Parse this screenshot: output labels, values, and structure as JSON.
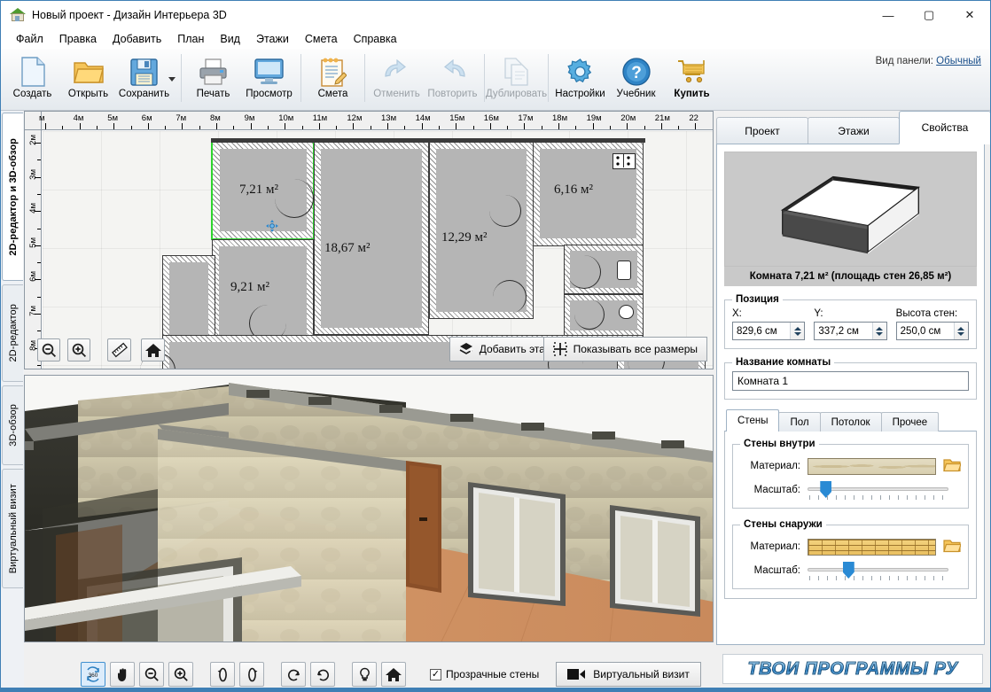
{
  "window": {
    "title": "Новый проект - Дизайн Интерьера 3D",
    "icon": "house-icon",
    "minimize": "—",
    "maximize": "▢",
    "close": "✕"
  },
  "menubar": {
    "items": [
      {
        "label": "Файл",
        "name": "menu-file"
      },
      {
        "label": "Правка",
        "name": "menu-edit"
      },
      {
        "label": "Добавить",
        "name": "menu-add"
      },
      {
        "label": "План",
        "name": "menu-plan"
      },
      {
        "label": "Вид",
        "name": "menu-view"
      },
      {
        "label": "Этажи",
        "name": "menu-floors"
      },
      {
        "label": "Смета",
        "name": "menu-estimate"
      },
      {
        "label": "Справка",
        "name": "menu-help"
      }
    ]
  },
  "ribbon": {
    "buttons": [
      {
        "label": "Создать",
        "icon": "new-document-icon",
        "enabled": true
      },
      {
        "label": "Открыть",
        "icon": "open-folder-icon",
        "enabled": true
      },
      {
        "label": "Сохранить",
        "icon": "save-floppy-icon",
        "enabled": true
      },
      {
        "label": "Печать",
        "icon": "printer-icon",
        "enabled": true
      },
      {
        "label": "Просмотр",
        "icon": "monitor-preview-icon",
        "enabled": true
      },
      {
        "label": "Смета",
        "icon": "notepad-estimate-icon",
        "enabled": true
      },
      {
        "label": "Отменить",
        "icon": "undo-arrow-icon",
        "enabled": false
      },
      {
        "label": "Повторить",
        "icon": "redo-arrow-icon",
        "enabled": false
      },
      {
        "label": "Дублировать",
        "icon": "duplicate-pages-icon",
        "enabled": false
      },
      {
        "label": "Настройки",
        "icon": "gear-icon",
        "enabled": true
      },
      {
        "label": "Учебник",
        "icon": "question-help-icon",
        "enabled": true
      },
      {
        "label": "Купить",
        "icon": "shopping-cart-icon",
        "enabled": true
      }
    ],
    "panel_view_label": "Вид панели:",
    "panel_view_value": "Обычный"
  },
  "left_tabs": [
    {
      "label": "2D-редактор и 3D-обзор",
      "active": true
    },
    {
      "label": "2D-редактор",
      "active": false
    },
    {
      "label": "3D-обзор",
      "active": false
    },
    {
      "label": "Виртуальный визит",
      "active": false
    }
  ],
  "plan": {
    "ruler_h_labels": [
      "м",
      "4м",
      "5м",
      "6м",
      "7м",
      "8м",
      "9м",
      "10м",
      "11м",
      "12м",
      "13м",
      "14м",
      "15м",
      "16м",
      "17м",
      "18м",
      "19м",
      "20м",
      "21м",
      "22"
    ],
    "ruler_v_labels": [
      "2м",
      "3м",
      "4м",
      "5м",
      "6м",
      "7м",
      "8м"
    ],
    "rooms": [
      {
        "area_label": "7,21 м²",
        "selected": true
      },
      {
        "area_label": "18,67 м²",
        "selected": false
      },
      {
        "area_label": "9,21 м²",
        "selected": false
      },
      {
        "area_label": "12,29 м²",
        "selected": false
      },
      {
        "area_label": "6,16 м²",
        "selected": false
      }
    ],
    "tools": [
      {
        "name": "zoom-out-icon",
        "glyph": "zoom-out"
      },
      {
        "name": "zoom-in-icon",
        "glyph": "zoom-in"
      },
      {
        "name": "ruler-icon",
        "glyph": "ruler"
      },
      {
        "name": "home-icon",
        "glyph": "home"
      }
    ],
    "add_floor_label": "Добавить этаж",
    "show_all_sizes_label": "Показывать все размеры"
  },
  "bottom_toolbar": {
    "buttons": [
      {
        "name": "orbit-360-icon",
        "label": "360",
        "active": true
      },
      {
        "name": "pan-hand-icon",
        "label": "✋",
        "active": false
      },
      {
        "name": "zoom-out-icon",
        "label": "−",
        "active": false
      },
      {
        "name": "zoom-in-icon",
        "label": "+",
        "active": false
      },
      {
        "name": "rotate-left-icon",
        "label": "↺",
        "active": false
      },
      {
        "name": "rotate-right-icon",
        "label": "↻",
        "active": false
      },
      {
        "name": "tilt-ccw-icon",
        "label": "⟲",
        "active": false
      },
      {
        "name": "tilt-cw-icon",
        "label": "⟳",
        "active": false
      },
      {
        "name": "light-bulb-icon",
        "label": "💡",
        "active": false
      },
      {
        "name": "home-icon",
        "label": "⌂",
        "active": false
      }
    ],
    "transparent_walls_label": "Прозрачные стены",
    "transparent_walls_checked": true,
    "virtual_visit_label": "Виртуальный визит"
  },
  "right_panel": {
    "tabs": [
      {
        "label": "Проект",
        "active": false
      },
      {
        "label": "Этажи",
        "active": false
      },
      {
        "label": "Свойства",
        "active": true
      }
    ],
    "preview_caption": "Комната 7,21 м²  (площадь стен 26,85 м²)",
    "position": {
      "legend": "Позиция",
      "x_label": "X:",
      "x_value": "829,6 см",
      "y_label": "Y:",
      "y_value": "337,2 см",
      "h_label": "Высота стен:",
      "h_value": "250,0 см"
    },
    "room_name": {
      "legend": "Название комнаты",
      "value": "Комната 1"
    },
    "surface_tabs": [
      {
        "label": "Стены",
        "active": true
      },
      {
        "label": "Пол",
        "active": false
      },
      {
        "label": "Потолок",
        "active": false
      },
      {
        "label": "Прочее",
        "active": false
      }
    ],
    "walls_inside": {
      "legend": "Стены внутри",
      "material_label": "Материал:",
      "material_swatch": "plaster-beige-texture",
      "scale_label": "Масштаб:",
      "scale_percent": 9,
      "browse_icon": "open-folder-icon"
    },
    "walls_outside": {
      "legend": "Стены снаружи",
      "material_label": "Материал:",
      "material_swatch": "yellow-brick-texture",
      "scale_label": "Масштаб:",
      "scale_percent": 25,
      "browse_icon": "open-folder-icon"
    }
  },
  "watermark": {
    "text": "ТВОИ ПРОГРАММЫ РУ"
  },
  "colors": {
    "accent": "#3f7fb5",
    "selection_green": "#2ed52e",
    "slider_blue": "#2a8ad4",
    "wall_dark": "#3b3b3b",
    "room_fill": "#b5b5b5"
  }
}
